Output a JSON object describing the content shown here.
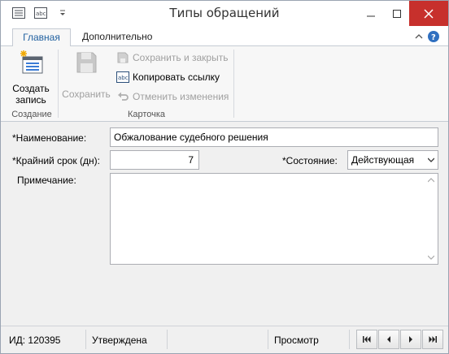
{
  "window": {
    "title": "Типы обращений"
  },
  "ribbon": {
    "tabs": [
      {
        "label": "Главная",
        "active": true
      },
      {
        "label": "Дополнительно",
        "active": false
      }
    ],
    "groups": {
      "create": {
        "label": "Создание",
        "new_record_line1": "Создать",
        "new_record_line2": "запись"
      },
      "card": {
        "label": "Карточка",
        "save": "Сохранить",
        "save_close": "Сохранить и закрыть",
        "copy_link": "Копировать ссылку",
        "undo_changes": "Отменить изменения"
      }
    }
  },
  "form": {
    "name_label": "*Наименование:",
    "name_value": "Обжалование судебного решения",
    "deadline_label": "*Крайний срок (дн):",
    "deadline_value": "7",
    "status_label": "*Состояние:",
    "status_value": "Действующая",
    "note_label": "Примечание:",
    "note_value": ""
  },
  "statusbar": {
    "id_text": "ИД: 120395",
    "approval": "Утверждена",
    "mode": "Просмотр"
  },
  "colors": {
    "accent": "#1f5f9f",
    "close_button": "#c7302c",
    "help_icon": "#2f6fc0"
  }
}
